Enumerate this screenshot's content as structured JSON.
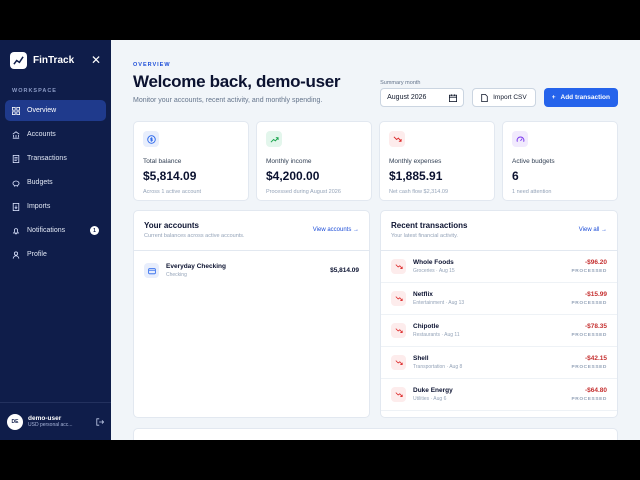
{
  "app": {
    "name": "FinTrack"
  },
  "sidebar": {
    "section_label": "WORKSPACE",
    "items": [
      {
        "label": "Overview"
      },
      {
        "label": "Accounts"
      },
      {
        "label": "Transactions"
      },
      {
        "label": "Budgets"
      },
      {
        "label": "Imports"
      },
      {
        "label": "Notifications",
        "badge": "1"
      },
      {
        "label": "Profile"
      }
    ],
    "user": {
      "initials": "DE",
      "name": "demo-user",
      "subtitle": "USD personal acc..."
    }
  },
  "header": {
    "eyebrow": "OVERVIEW",
    "title": "Welcome back, demo-user",
    "subtitle": "Monitor your accounts, recent activity, and monthly spending.",
    "month_label": "Summary month",
    "month_value": "August 2026",
    "import_label": "Import CSV",
    "add_label": "Add transaction"
  },
  "stats": [
    {
      "label": "Total balance",
      "value": "$5,814.09",
      "note": "Across 1 active account"
    },
    {
      "label": "Monthly income",
      "value": "$4,200.00",
      "note": "Processed during August 2026"
    },
    {
      "label": "Monthly expenses",
      "value": "$1,885.91",
      "note": "Net cash flow $2,314.09"
    },
    {
      "label": "Active budgets",
      "value": "6",
      "note": "1 need attention"
    }
  ],
  "accounts": {
    "title": "Your accounts",
    "subtitle": "Current balances across active accounts.",
    "link": "View accounts",
    "items": [
      {
        "name": "Everyday Checking",
        "type": "Checking",
        "amount": "$5,814.09"
      }
    ]
  },
  "transactions": {
    "title": "Recent transactions",
    "subtitle": "Your latest financial activity.",
    "link": "View all",
    "items": [
      {
        "name": "Whole Foods",
        "meta": "Groceries · Aug 15",
        "amount": "-$96.20",
        "status": "PROCESSED"
      },
      {
        "name": "Netflix",
        "meta": "Entertainment · Aug 13",
        "amount": "-$15.99",
        "status": "PROCESSED"
      },
      {
        "name": "Chipotle",
        "meta": "Restaurants · Aug 11",
        "amount": "-$78.35",
        "status": "PROCESSED"
      },
      {
        "name": "Shell",
        "meta": "Transportation · Aug 8",
        "amount": "-$42.15",
        "status": "PROCESSED"
      },
      {
        "name": "Duke Energy",
        "meta": "Utilities · Aug 6",
        "amount": "-$64.80",
        "status": "PROCESSED"
      }
    ]
  },
  "colors": {
    "sidebar": "#0f1d4a",
    "accent": "#2563eb",
    "negative": "#c53030"
  }
}
